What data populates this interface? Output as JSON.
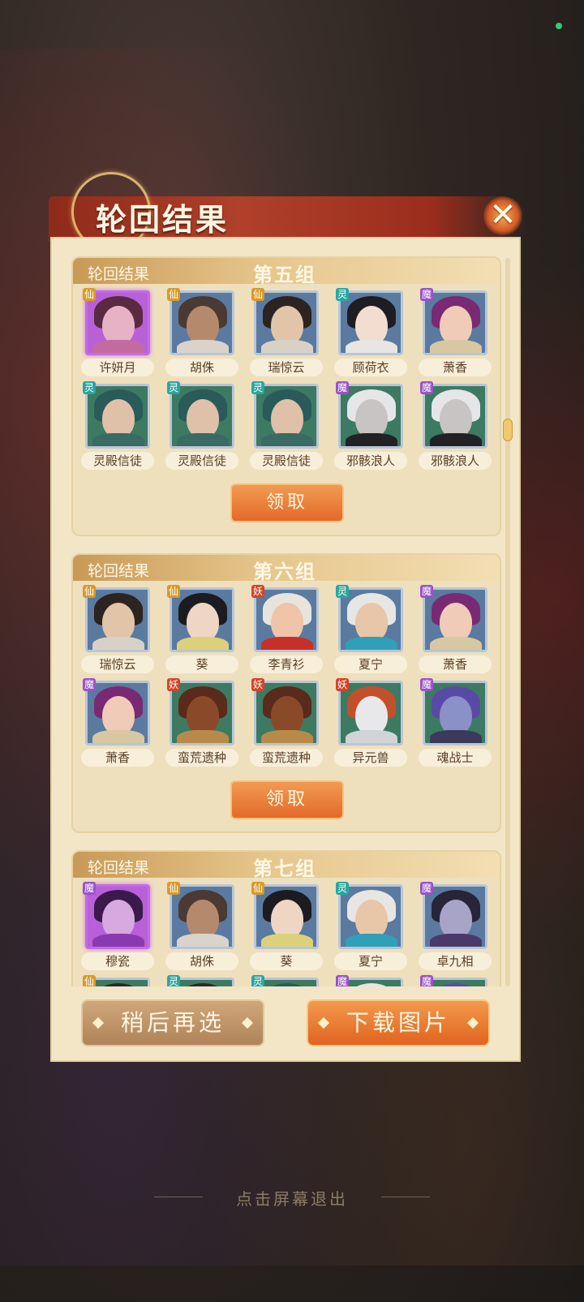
{
  "title": "轮回结果",
  "close_icon": "close-icon",
  "groups": [
    {
      "label": "轮回结果",
      "name": "第五组",
      "claim_label": "领取",
      "cards": [
        {
          "name": "许妍月",
          "badge": "仙",
          "frame": "purple",
          "palette": [
            "#e7b2c6",
            "#5a2a40",
            "#c36aa0"
          ]
        },
        {
          "name": "胡侏",
          "badge": "仙",
          "frame": "blue",
          "palette": [
            "#b58a6c",
            "#4a3a33",
            "#d9d3cc"
          ]
        },
        {
          "name": "瑞惊云",
          "badge": "仙",
          "frame": "blue",
          "palette": [
            "#e2c4a8",
            "#2c2420",
            "#d8d2c6"
          ]
        },
        {
          "name": "顾荷衣",
          "badge": "灵",
          "frame": "blue",
          "palette": [
            "#f2ddd0",
            "#1d1d22",
            "#e8e6e2"
          ]
        },
        {
          "name": "萧香",
          "badge": "魔",
          "frame": "blue",
          "palette": [
            "#f0cbb8",
            "#7a2a72",
            "#d7c8a2"
          ]
        },
        {
          "name": "灵殿信徒",
          "badge": "灵",
          "frame": "green",
          "palette": [
            "#dfc0a8",
            "#2a5a5a",
            "#3a6a64"
          ]
        },
        {
          "name": "灵殿信徒",
          "badge": "灵",
          "frame": "green",
          "palette": [
            "#dfc0a8",
            "#2a5a5a",
            "#3a6a64"
          ]
        },
        {
          "name": "灵殿信徒",
          "badge": "灵",
          "frame": "green",
          "palette": [
            "#dfc0a8",
            "#2a5a5a",
            "#3a6a64"
          ]
        },
        {
          "name": "邪骸浪人",
          "badge": "魔",
          "frame": "green",
          "palette": [
            "#c8c4c4",
            "#e6e6e8",
            "#222226"
          ]
        },
        {
          "name": "邪骸浪人",
          "badge": "魔",
          "frame": "green",
          "palette": [
            "#c8c4c4",
            "#e6e6e8",
            "#222226"
          ]
        }
      ]
    },
    {
      "label": "轮回结果",
      "name": "第六组",
      "claim_label": "领取",
      "cards": [
        {
          "name": "瑞惊云",
          "badge": "仙",
          "frame": "blue",
          "palette": [
            "#e2c4a8",
            "#2c2420",
            "#d8d2c6"
          ]
        },
        {
          "name": "葵",
          "badge": "仙",
          "frame": "blue",
          "palette": [
            "#efd6c4",
            "#1c1c20",
            "#dcd07a"
          ]
        },
        {
          "name": "李青衫",
          "badge": "妖",
          "frame": "blue",
          "palette": [
            "#f0c4a8",
            "#e8e4dc",
            "#c63028"
          ]
        },
        {
          "name": "夏宁",
          "badge": "灵",
          "frame": "blue",
          "palette": [
            "#e8c6a8",
            "#e8e6e2",
            "#2fa0b8"
          ]
        },
        {
          "name": "萧香",
          "badge": "魔",
          "frame": "blue",
          "palette": [
            "#f0cbb8",
            "#7a2a72",
            "#d7c8a2"
          ]
        },
        {
          "name": "萧香",
          "badge": "魔",
          "frame": "blue",
          "palette": [
            "#f0cbb8",
            "#7a2a72",
            "#d7c8a2"
          ]
        },
        {
          "name": "蛮荒遗种",
          "badge": "妖",
          "frame": "green",
          "palette": [
            "#8a4a2a",
            "#5a2a1a",
            "#b88a4a"
          ]
        },
        {
          "name": "蛮荒遗种",
          "badge": "妖",
          "frame": "green",
          "palette": [
            "#8a4a2a",
            "#5a2a1a",
            "#b88a4a"
          ]
        },
        {
          "name": "异元兽",
          "badge": "妖",
          "frame": "green",
          "palette": [
            "#e8e8ea",
            "#c2502a",
            "#d0d4d6"
          ]
        },
        {
          "name": "魂战士",
          "badge": "魔",
          "frame": "green",
          "palette": [
            "#8a90c8",
            "#5a4aa8",
            "#3a3a5a"
          ]
        }
      ]
    },
    {
      "label": "轮回结果",
      "name": "第七组",
      "claim_label": "领取",
      "cards": [
        {
          "name": "穆瓷",
          "badge": "魔",
          "frame": "purple",
          "palette": [
            "#d8a8e0",
            "#3a1a4a",
            "#8a3ab0"
          ]
        },
        {
          "name": "胡侏",
          "badge": "仙",
          "frame": "blue",
          "palette": [
            "#b58a6c",
            "#4a3a33",
            "#d9d3cc"
          ]
        },
        {
          "name": "葵",
          "badge": "仙",
          "frame": "blue",
          "palette": [
            "#efd6c4",
            "#1c1c20",
            "#dcd07a"
          ]
        },
        {
          "name": "夏宁",
          "badge": "灵",
          "frame": "blue",
          "palette": [
            "#e8c6a8",
            "#e8e6e2",
            "#2fa0b8"
          ]
        },
        {
          "name": "卓九相",
          "badge": "魔",
          "frame": "blue",
          "palette": [
            "#a8a4c8",
            "#2a2438",
            "#4a3a6a"
          ]
        },
        {
          "name": "",
          "badge": "仙",
          "frame": "green",
          "palette": [
            "#c8a888",
            "#2a2a2a",
            "#3a6a5a"
          ]
        },
        {
          "name": "",
          "badge": "灵",
          "frame": "green",
          "palette": [
            "#c8a888",
            "#2a2a2a",
            "#3a6a5a"
          ]
        },
        {
          "name": "",
          "badge": "灵",
          "frame": "green",
          "palette": [
            "#c8a888",
            "#2a5a5a",
            "#3a6a5a"
          ]
        },
        {
          "name": "",
          "badge": "魔",
          "frame": "green",
          "palette": [
            "#c8c4c4",
            "#e6e6e8",
            "#222226"
          ]
        },
        {
          "name": "",
          "badge": "魔",
          "frame": "green",
          "palette": [
            "#8a90c8",
            "#5a4aa8",
            "#3a3a5a"
          ]
        }
      ]
    }
  ],
  "buttons": {
    "later": "稍后再选",
    "download": "下载图片"
  },
  "exit_hint": "点击屏幕退出",
  "colors": {
    "badge_仙": "#d99a2a",
    "badge_灵": "#2aa6a0",
    "badge_魔": "#9a52c8",
    "badge_妖": "#d2452a",
    "frame_blue_bg": "#5a7aa0",
    "frame_green_bg": "#3d7a62",
    "frame_purple_bg": "#b860d8"
  }
}
